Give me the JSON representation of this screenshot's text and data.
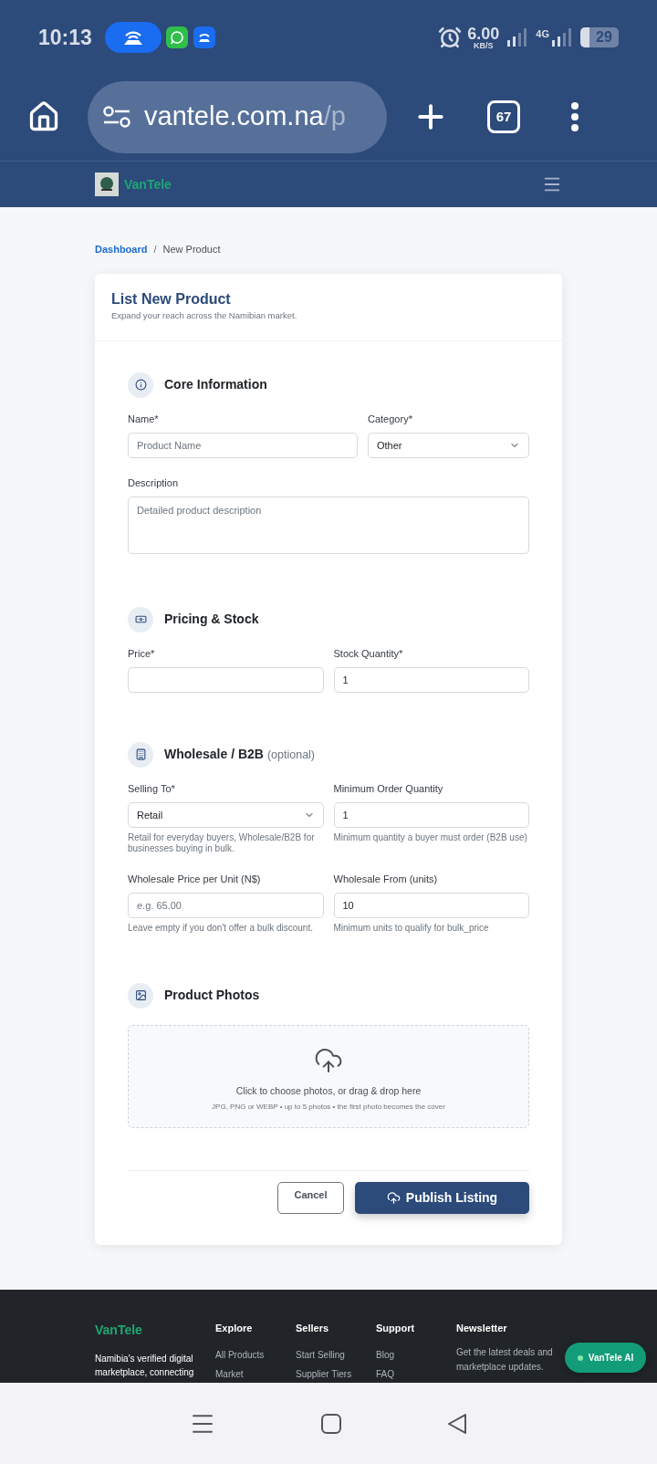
{
  "status_bar": {
    "time": "10:13",
    "speed": "6.00",
    "speed_unit": "KB/S",
    "network": "4G",
    "battery": "29"
  },
  "browser": {
    "url_host": "vantele.com.na",
    "url_path": "/p",
    "tab_count": "67"
  },
  "site_header": {
    "brand": "VanTele"
  },
  "breadcrumb": [
    {
      "label": "Dashboard",
      "kind": "link"
    },
    {
      "label": "New Product",
      "kind": "current"
    }
  ],
  "breadcrumb_separator": "/",
  "card": {
    "title": "List New Product",
    "subtitle": "Expand your reach across the Namibian market.",
    "sections": [
      {
        "kind": "core",
        "title": "Core Information",
        "rows": [
          [
            {
              "label": "Name*",
              "kind": "text",
              "placeholder": "Product Name"
            },
            {
              "label": "Category*",
              "kind": "select",
              "value": "Other"
            }
          ],
          [
            {
              "label": "Description",
              "kind": "textarea",
              "placeholder": "Detailed product description"
            }
          ]
        ]
      },
      {
        "kind": "pricing",
        "title": "Pricing & Stock",
        "rows": [
          [
            {
              "label": "Price*",
              "kind": "text"
            },
            {
              "label": "Stock Quantity*",
              "kind": "text",
              "value": "1"
            }
          ]
        ]
      },
      {
        "kind": "wholesale",
        "title": "Wholesale / B2B",
        "note": "(optional)",
        "rows": [
          [
            {
              "label": "Selling To*",
              "kind": "select",
              "value": "Retail",
              "help": "Retail for everyday buyers, Wholesale/B2B for businesses buying in bulk."
            },
            {
              "label": "Minimum Order Quantity",
              "kind": "text",
              "value": "1",
              "help": "Minimum quantity a buyer must order (B2B use)"
            }
          ],
          [
            {
              "label": "Wholesale Price per Unit (N$)",
              "kind": "text",
              "placeholder": "e.g. 65.00",
              "help": "Leave empty if you don't offer a bulk discount."
            },
            {
              "label": "Wholesale From (units)",
              "kind": "text",
              "value": "10",
              "help": "Minimum units to qualify for bulk_price"
            }
          ]
        ]
      },
      {
        "kind": "upload",
        "title": "Product Photos",
        "upload": {
          "text": "Click to choose photos, or drag & drop here",
          "hint": "JPG, PNG or WEBP • up to 5 photos • the first photo becomes the cover"
        }
      }
    ],
    "actions": [
      {
        "label": "Cancel",
        "kind": "secondary"
      },
      {
        "label": "Publish Listing",
        "kind": "primary"
      }
    ]
  },
  "footer": {
    "brand": "VanTele",
    "tagline": "Namibia's verified digital marketplace, connecting",
    "columns": [
      {
        "title": "Explore",
        "links": [
          "All Products",
          "Market"
        ]
      },
      {
        "title": "Sellers",
        "links": [
          "Start Selling",
          "Supplier Tiers"
        ]
      },
      {
        "title": "Support",
        "links": [
          "Blog",
          "FAQ"
        ]
      }
    ],
    "newsletter": {
      "title": "Newsletter",
      "text": "Get the latest deals and marketplace updates."
    },
    "chat_button": "VanTele AI"
  }
}
